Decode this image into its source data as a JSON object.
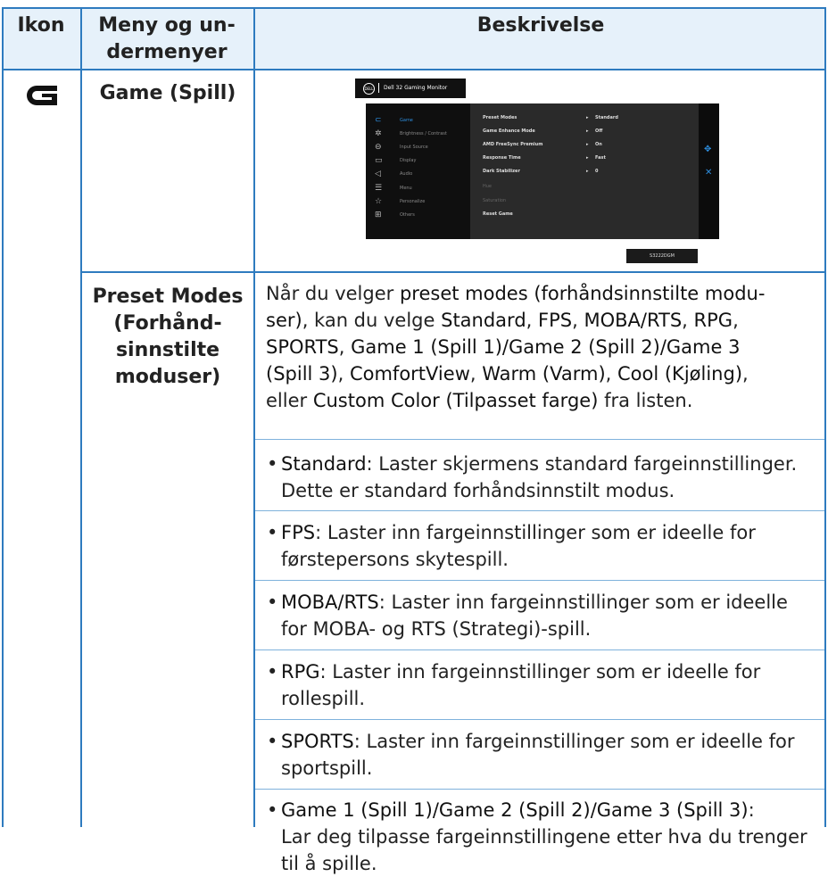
{
  "header": {
    "icon_col": "Ikon",
    "menu_col": "Meny og un-\ndermenyer",
    "desc_col": "Beskrivelse"
  },
  "row_game": {
    "icon": "game-g-icon",
    "menu_label": "Game (Spill)",
    "osd": {
      "title": "Dell 32 Gaming Monitor",
      "menu_items": [
        {
          "label": "Game",
          "icon": "game-icon"
        },
        {
          "label": "Brightness / Contrast",
          "icon": "brightness-icon"
        },
        {
          "label": "Input Source",
          "icon": "input-icon"
        },
        {
          "label": "Display",
          "icon": "display-icon"
        },
        {
          "label": "Audio",
          "icon": "audio-icon"
        },
        {
          "label": "Menu",
          "icon": "menu-icon"
        },
        {
          "label": "Personalize",
          "icon": "star-icon"
        },
        {
          "label": "Others",
          "icon": "others-icon"
        }
      ],
      "options": [
        {
          "label": "Preset Modes",
          "value": "Standard"
        },
        {
          "label": "Game Enhance Mode",
          "value": "Off"
        },
        {
          "label": "AMD FreeSync Premium",
          "value": "On"
        },
        {
          "label": "Response Time",
          "value": "Fast"
        },
        {
          "label": "Dark Stabilizer",
          "value": "0"
        },
        {
          "label": "Hue",
          "value": ""
        },
        {
          "label": "Saturation",
          "value": ""
        },
        {
          "label": "Reset Game",
          "value": ""
        }
      ],
      "model": "S3222DGM"
    }
  },
  "row_preset": {
    "menu_label": "Preset Modes\n(Forhånd-\nsinnstilte\nmoduser)",
    "intro": {
      "p1": "Når du velger ",
      "k1": "preset modes (forhåndsinnstilte modu-\nser)",
      "p2": ", kan du velge ",
      "k2": "Standard",
      "p3": ", ",
      "k3": "FPS",
      "p4": ", ",
      "k4": "MOBA/RTS",
      "p5": ", ",
      "k5": "RPG",
      "p6": ",",
      "k6": "SPORTS",
      "p7": ", ",
      "k7": "Game 1 (Spill 1)/Game 2 (Spill 2)/Game 3\n(Spill 3)",
      "p8": ", ",
      "k8": "ComfortView",
      "p9": ", ",
      "k9": "Warm (Varm)",
      "p10": ", ",
      "k10": "Cool (Kjøling)",
      "p11": ",\neller ",
      "k11": "Custom Color (Tilpasset farge)",
      "p12": " fra listen."
    },
    "bullets": [
      {
        "key": "Standard",
        "text": ": Laster skjermens standard fargeinnstillinger.",
        "text2": "Dette er standard forhåndsinnstilt modus."
      },
      {
        "key": "FPS",
        "text": ": Laster inn fargeinnstillinger som er ideelle for",
        "text2": "førstepersons skytespill."
      },
      {
        "key": "MOBA/RTS",
        "text": ": Laster inn fargeinnstillinger som er ideelle",
        "text2": "for MOBA- og RTS (Strategi)-spill."
      },
      {
        "key": "RPG",
        "text": ": Laster inn fargeinnstillinger som er ideelle for",
        "text2": "rollespill."
      },
      {
        "key": "SPORTS",
        "text": ": Laster inn fargeinnstillinger som er ideelle for",
        "text2": "sportspill."
      },
      {
        "key": "Game 1 (Spill 1)/Game 2 (Spill 2)/Game 3 (Spill 3)",
        "text": ":",
        "text2": "Lar deg tilpasse fargeinnstillingene etter hva du trenger",
        "text3": "til å spille."
      }
    ]
  },
  "colors": {
    "border": "#2e7bbf",
    "header_bg": "#e6f1fa"
  }
}
